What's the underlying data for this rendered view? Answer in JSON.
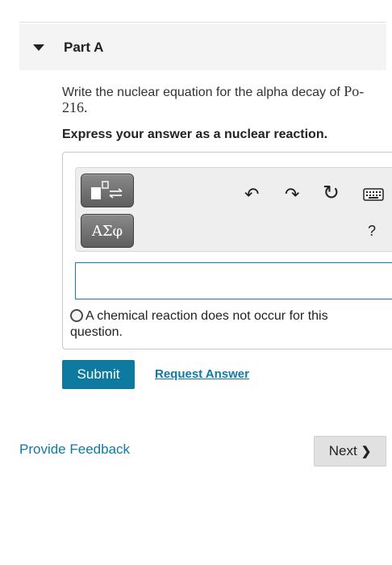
{
  "part": {
    "title": "Part A"
  },
  "question": {
    "text": "Write the nuclear equation for the alpha decay of ",
    "isotope": "Po-216",
    "end": "."
  },
  "instruction": "Express your answer as a nuclear reaction.",
  "toolbar": {
    "symbols_label": "ΑΣφ",
    "undo_glyph": "↶",
    "redo_glyph": "↷",
    "reset_glyph": "↻",
    "help_label": "?"
  },
  "answer": {
    "value": "",
    "placeholder": ""
  },
  "no_reaction_label": "A chemical reaction does not occur for this question.",
  "actions": {
    "submit_label": "Submit",
    "request_answer_label": "Request Answer"
  },
  "footer": {
    "feedback_label": "Provide Feedback",
    "next_label": "Next"
  },
  "colors": {
    "accent": "#0f7aa0",
    "link": "#1378a3",
    "input_border": "#1a7eaa"
  }
}
